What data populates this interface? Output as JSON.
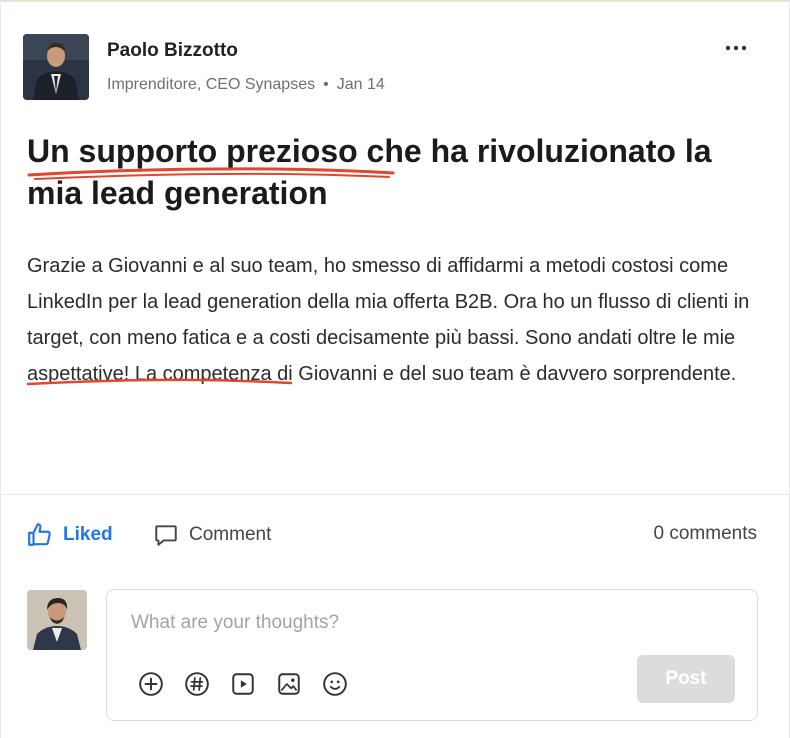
{
  "post": {
    "author_name": "Paolo Bizzotto",
    "author_role": "Imprenditore, CEO Synapses",
    "meta_separator": "•",
    "date": "Jan 14",
    "more_label": "•••",
    "title": "Un supporto prezioso che ha rivoluzionato la mia lead generation",
    "body": "Grazie a Giovanni e al suo team, ho smesso di affidarmi a metodi costosi come LinkedIn per la lead generation della mia offerta B2B. Ora ho un flusso di clienti in target, con meno fatica e a costi decisamente più bassi. Sono andati oltre le mie aspettative! La competenza di Giovanni e del suo team è davvero sorprendente."
  },
  "actions": {
    "liked_label": "Liked",
    "comment_label": "Comment",
    "comments_count": "0 comments"
  },
  "composer": {
    "placeholder": "What are your thoughts?",
    "value": "",
    "post_label": "Post",
    "tools": [
      "add-icon",
      "hashtag-icon",
      "video-icon",
      "image-icon",
      "emoji-icon"
    ]
  },
  "colors": {
    "accent": "#2376e5",
    "underline": "#e2462f",
    "post_button_disabled": "#dcdcdc"
  }
}
